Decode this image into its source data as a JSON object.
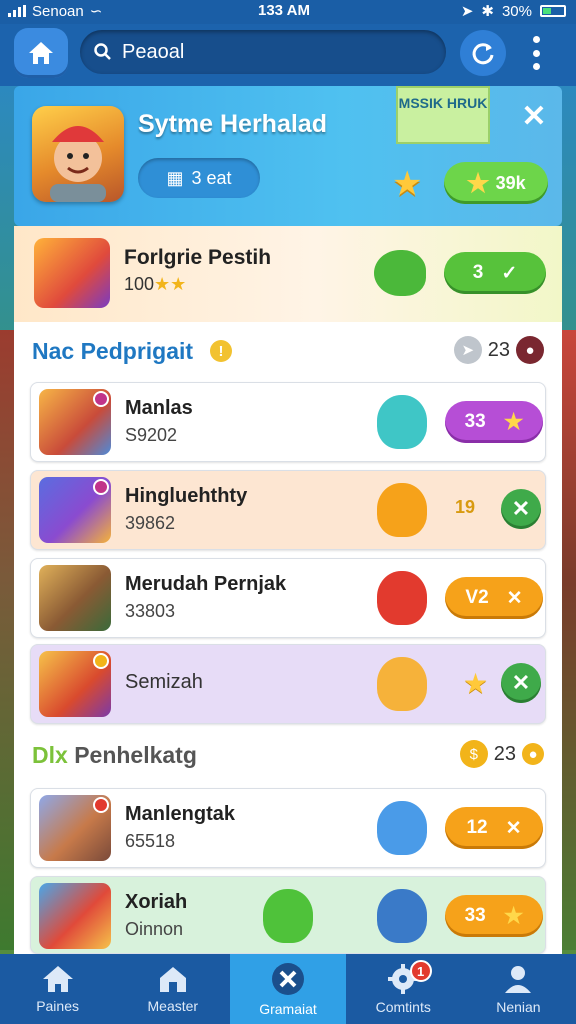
{
  "statusbar": {
    "carrier": "Senoan",
    "time": "133 AM",
    "battery": "30%"
  },
  "header": {
    "search_value": "Peaoal"
  },
  "featured": {
    "title": "Sytme Herhalad",
    "chip_label": "3 eat",
    "tag_label": "MSSIK HRUK",
    "pill_label": "39k"
  },
  "highlight": {
    "name": "Forlgrie Pestih",
    "sub": "100",
    "pill_label": "3"
  },
  "section1": {
    "title": "Nac Pedprigait",
    "count": "23"
  },
  "section2": {
    "title_prefix": "Dlx",
    "title": "Penhelkatg",
    "count": "23"
  },
  "items": [
    {
      "name": "Manlas",
      "sub": "S9202",
      "pill_label": "33"
    },
    {
      "name": "Hingluehthty",
      "sub": "39862",
      "side_label": "19"
    },
    {
      "name": "Merudah Pernjak",
      "sub": "33803",
      "pill_label": "V2"
    },
    {
      "name": "",
      "sub": "Semizah"
    },
    {
      "name": "Manlengtak",
      "sub": "65518",
      "pill_label": "12"
    },
    {
      "name": "Xoriah",
      "sub": "Oinnon",
      "pill_label": "33"
    }
  ],
  "bottom_nav": [
    {
      "label": "Paines"
    },
    {
      "label": "Measter"
    },
    {
      "label": "Gramaiat"
    },
    {
      "label": "Comtints",
      "badge": "1"
    },
    {
      "label": "Nenian"
    }
  ],
  "colors": {
    "brand": "#1c63ad",
    "accent": "#30a0e6",
    "green": "#57c23b",
    "orange": "#f6a21a",
    "purple": "#b64ed6"
  },
  "icons": [
    "home-icon",
    "search-icon",
    "refresh-icon",
    "more-icon",
    "close-icon",
    "star-icon",
    "tick-icon",
    "info-icon"
  ]
}
